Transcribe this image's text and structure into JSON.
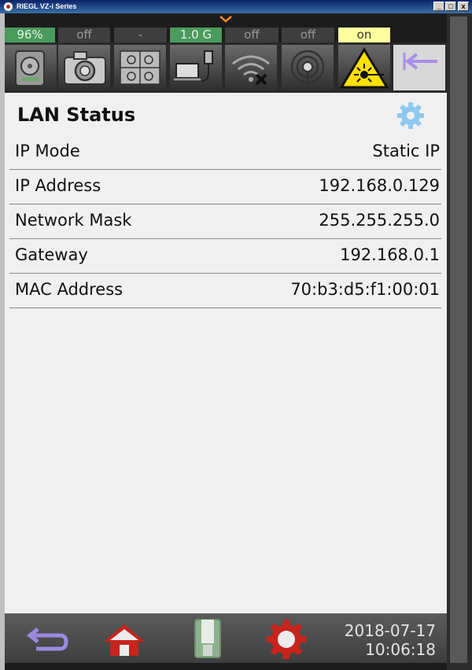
{
  "window": {
    "title": "RIEGL VZ-i Series",
    "controls": [
      "_",
      "□",
      "x"
    ]
  },
  "status_bar": [
    {
      "id": "battery",
      "value": "96%",
      "color": "green"
    },
    {
      "id": "camera",
      "value": "off",
      "color": "gray"
    },
    {
      "id": "registration",
      "value": "-",
      "color": "gray"
    },
    {
      "id": "lan",
      "value": "1.0 G",
      "color": "green"
    },
    {
      "id": "wifi",
      "value": "off",
      "color": "gray"
    },
    {
      "id": "gnss",
      "value": "off",
      "color": "gray"
    },
    {
      "id": "laser",
      "value": "on",
      "color": "yellow"
    }
  ],
  "toolbar": {
    "icons": [
      "storage-icon",
      "camera-icon",
      "registration-icon",
      "lan-icon",
      "wifi-off-icon",
      "antenna-icon",
      "laser-warning-icon",
      "collapse-left-icon"
    ]
  },
  "lan": {
    "title": "LAN Status",
    "rows": [
      {
        "label": "IP Mode",
        "value": "Static IP"
      },
      {
        "label": "IP Address",
        "value": "192.168.0.129"
      },
      {
        "label": "Network Mask",
        "value": "255.255.255.0"
      },
      {
        "label": "Gateway",
        "value": "192.168.0.1"
      },
      {
        "label": "MAC Address",
        "value": "70:b3:d5:f1:00:01"
      }
    ]
  },
  "footer": {
    "date": "2018-07-17",
    "time": "10:06:18",
    "icons": [
      "back-icon",
      "home-icon",
      "scanner-icon",
      "settings-gear-icon"
    ]
  },
  "colors": {
    "accent_green": "#4a9b5c",
    "laser_yellow": "#ffffa0",
    "gear_blue": "#8ec8f0",
    "back_purple": "#9b8ae0",
    "home_red": "#c8241c"
  }
}
